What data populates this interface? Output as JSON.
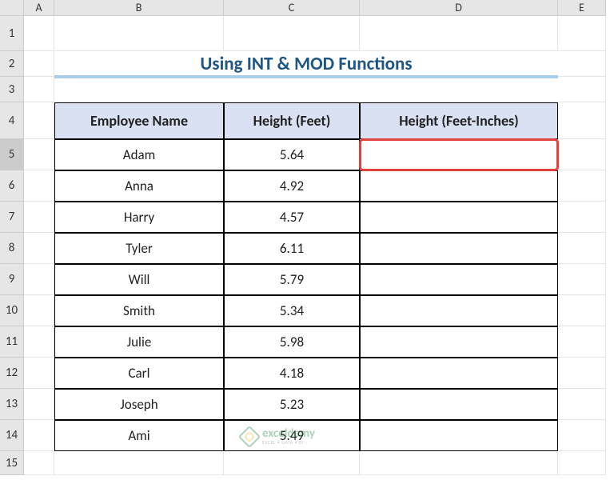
{
  "columns": [
    "A",
    "B",
    "C",
    "D",
    "E"
  ],
  "rows": [
    "1",
    "2",
    "3",
    "4",
    "5",
    "6",
    "7",
    "8",
    "9",
    "10",
    "11",
    "12",
    "13",
    "14",
    "15"
  ],
  "title": "Using INT & MOD Functions",
  "headers": {
    "b": "Employee Name",
    "c": "Height (Feet)",
    "d": "Height (Feet-Inches)"
  },
  "chart_data": {
    "type": "table",
    "title": "Using INT & MOD Functions",
    "columns": [
      "Employee Name",
      "Height (Feet)",
      "Height (Feet-Inches)"
    ],
    "rows": [
      {
        "name": "Adam",
        "feet": "5.64",
        "feet_inches": ""
      },
      {
        "name": "Anna",
        "feet": "4.92",
        "feet_inches": ""
      },
      {
        "name": "Harry",
        "feet": "4.57",
        "feet_inches": ""
      },
      {
        "name": "Tyler",
        "feet": "6.11",
        "feet_inches": ""
      },
      {
        "name": "Will",
        "feet": "5.79",
        "feet_inches": ""
      },
      {
        "name": "Smith",
        "feet": "5.34",
        "feet_inches": ""
      },
      {
        "name": "Julie",
        "feet": "5.98",
        "feet_inches": ""
      },
      {
        "name": "Carl",
        "feet": "4.18",
        "feet_inches": ""
      },
      {
        "name": "Joseph",
        "feet": "5.23",
        "feet_inches": ""
      },
      {
        "name": "Ami",
        "feet": "5.49",
        "feet_inches": ""
      }
    ]
  },
  "selected_cell": "D5",
  "watermark": {
    "main": "exceldemy",
    "sub": "EXCEL • DATA • BI"
  }
}
